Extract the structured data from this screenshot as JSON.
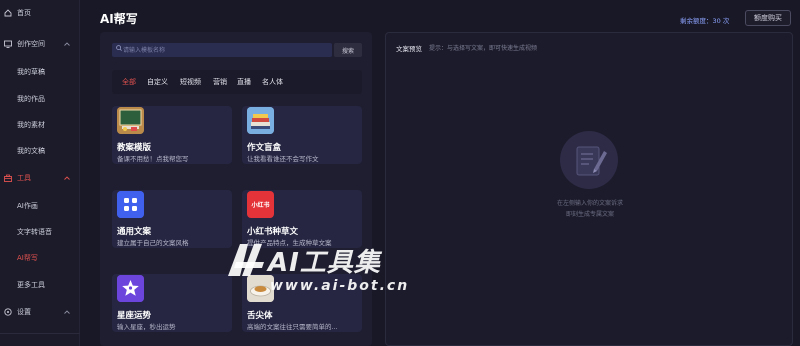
{
  "sidebar": {
    "items": [
      {
        "label": "首页",
        "icon": "home-icon"
      },
      {
        "label": "创作空间",
        "icon": "monitor-icon",
        "chevron": "^"
      },
      {
        "label": "我的草稿"
      },
      {
        "label": "我的作品"
      },
      {
        "label": "我的素材"
      },
      {
        "label": "我的文稿"
      },
      {
        "label": "工具",
        "icon": "toolbox-icon",
        "chevron": "^"
      },
      {
        "label": "AI作画"
      },
      {
        "label": "文字转语音"
      },
      {
        "label": "AI帮写"
      },
      {
        "label": "更多工具"
      },
      {
        "label": "设置",
        "icon": "settings-icon",
        "chevron": "^"
      }
    ]
  },
  "header": {
    "title": "AI帮写",
    "quota": "剩余额度：30 次",
    "buy_label": "额度购买"
  },
  "search": {
    "placeholder": "请输入模板名称",
    "button_label": "搜索"
  },
  "tabs": [
    "全部",
    "自定义",
    "短视频",
    "营销",
    "直播",
    "名人体"
  ],
  "cards": [
    {
      "title": "教案模版",
      "desc": "备课不用愁！点我帮您写",
      "icon": "blackboard-icon"
    },
    {
      "title": "作文盲盒",
      "desc": "让我看看谁还不会写作文",
      "icon": "books-icon"
    },
    {
      "title": "通用文案",
      "desc": "建立属于自己的文案风格",
      "icon": "apps-grid-icon"
    },
    {
      "title": "小红书种草文",
      "desc": "提供产品特点，生成种草文案",
      "icon": "xiaohongshu-icon",
      "icon_text": "小红书"
    },
    {
      "title": "星座运势",
      "desc": "输入星座，秒出运势",
      "icon": "star-icon"
    },
    {
      "title": "舌尖体",
      "desc": "高端的文案往往只需要简单的...",
      "icon": "dish-icon"
    }
  ],
  "preview": {
    "title": "文案预览",
    "hint": "提示：与选择写文案，即可快速生成视频",
    "empty_line1": "在左侧输入你的文案诉求",
    "empty_line2": "即刻生成专属文案"
  },
  "watermark": {
    "text": "AI工具集",
    "url": "www.ai-bot.cn"
  },
  "colors": {
    "accent": "#e3524f",
    "link_blue": "#8fa4ff",
    "background": "#181826",
    "card": "#262642"
  }
}
